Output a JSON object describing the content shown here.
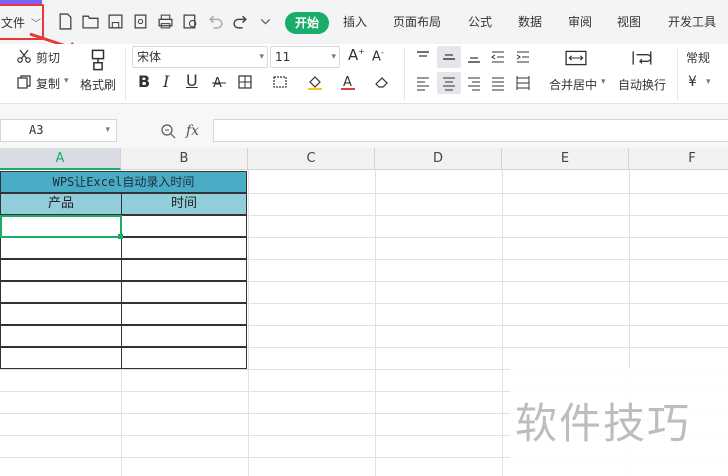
{
  "tabbar": {
    "file_menu": "文件",
    "tabs": [
      "开始",
      "插入",
      "页面布局",
      "公式",
      "数据",
      "审阅",
      "视图",
      "开发工具"
    ],
    "active_tab": "开始"
  },
  "ribbon": {
    "cut": "剪切",
    "copy": "复制",
    "format_painter": "格式刷",
    "font_name": "宋体",
    "font_size": "11",
    "bold": "B",
    "italic": "I",
    "underline": "U",
    "merge_center": "合并居中",
    "wrap_text": "自动换行",
    "number_format": "常规",
    "currency_symbol": "¥"
  },
  "formula_bar": {
    "name_box": "A3",
    "fx": "fx",
    "value": ""
  },
  "grid": {
    "columns": [
      "A",
      "B",
      "C",
      "D",
      "E",
      "F"
    ],
    "selected_column": "A",
    "merged_title": "WPS让Excel自动录入时间",
    "headers": [
      "产品",
      "时间"
    ]
  },
  "watermark": "软件技巧",
  "colors": {
    "accent": "#1aad6a",
    "title_fill": "#4bacc6",
    "header_fill": "#92cddc",
    "annotation_red": "#e53935"
  }
}
